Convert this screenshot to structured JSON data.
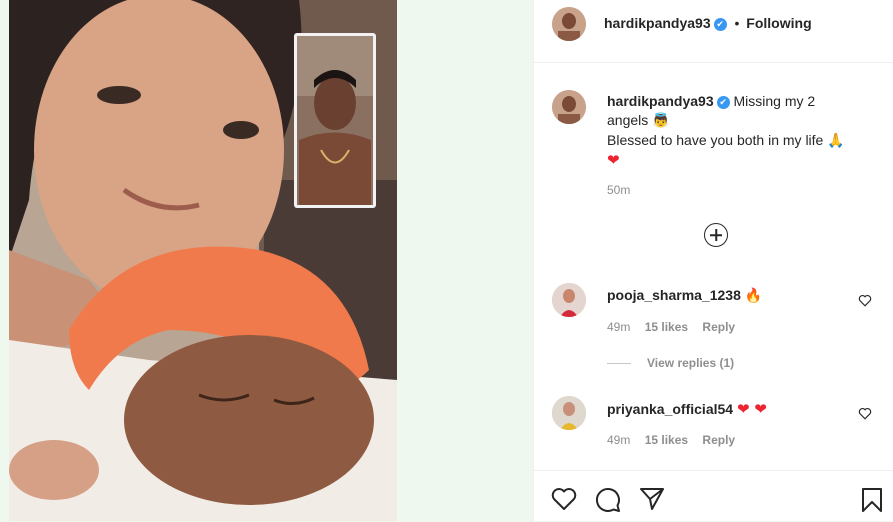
{
  "post": {
    "author": "hardikpandya93",
    "follow_state": "Following",
    "bullet": "•",
    "verified_icon": "✔",
    "caption_line1": "Missing my 2",
    "caption_line2": "angels",
    "caption_line3": "Blessed to have you both in my life",
    "emoji_angel": "👼",
    "emoji_pray": "🙏",
    "emoji_heart": "❤",
    "time_ago": "50m"
  },
  "comments": [
    {
      "user": "pooja_sharma_1238",
      "emoji": "🔥",
      "time": "49m",
      "likes": "15 likes",
      "reply": "Reply"
    },
    {
      "user": "priyanka_official54",
      "emoji": "❤ ❤",
      "time": "49m",
      "likes": "15 likes",
      "reply": "Reply"
    }
  ],
  "view_replies": "View replies (1)",
  "colors": {
    "background": "#eef8ee",
    "verified": "#3897f0",
    "heart": "#ed2330",
    "muted": "#8e8e8e"
  },
  "icons": [
    "like-icon",
    "comment-icon",
    "share-icon",
    "bookmark-icon",
    "load-more-icon",
    "comment-like-icon"
  ]
}
